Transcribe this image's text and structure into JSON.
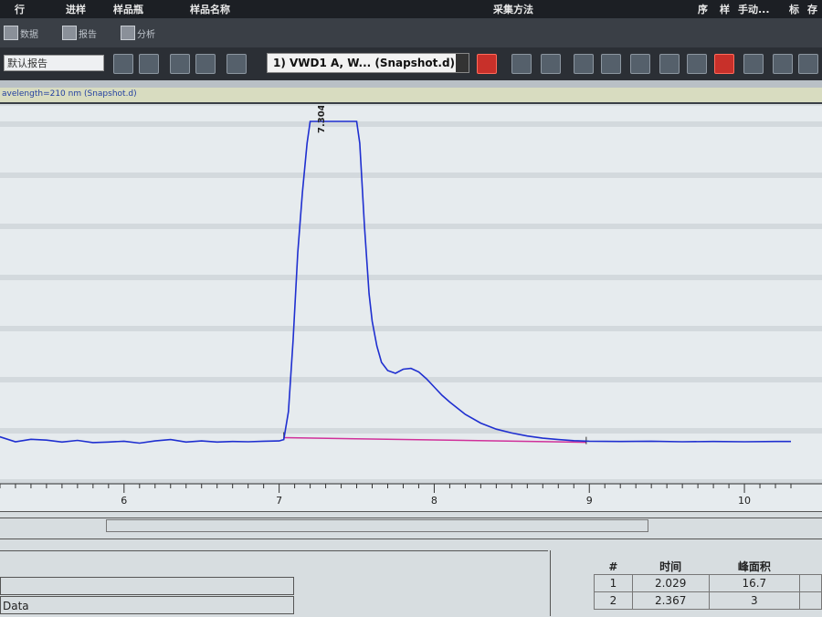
{
  "header": {
    "columns": [
      "行",
      "进样",
      "样品瓶",
      "样品名称",
      "采集方法",
      "序",
      "样",
      "手动...",
      "标",
      "存"
    ]
  },
  "mini_toolbar": {
    "items": [
      "数据",
      "报告",
      "分析"
    ]
  },
  "toolbar": {
    "report_selector": "默认报告",
    "signal_selector": "1) VWD1 A, W... (Snapshot.d)"
  },
  "signal_bar": {
    "title": "avelength=210 nm (Snapshot.d)"
  },
  "colors": {
    "trace": "#1f2fd0",
    "baseline": "#d0309a",
    "plot_bg": "#e6ebee",
    "accent_red": "#c8302a"
  },
  "chart_data": {
    "type": "line",
    "title": "",
    "xlabel": "",
    "ylabel": "",
    "xlim": [
      5.0,
      10.3
    ],
    "ylim": [
      0,
      100
    ],
    "x_ticks": [
      6,
      7,
      8,
      9,
      10
    ],
    "peak_label": "7.304",
    "peak_label_x": 7.304,
    "integration_baseline": {
      "x": [
        7.03,
        8.98
      ],
      "y": [
        2.5,
        0.8
      ]
    },
    "series": [
      {
        "x": [
          5.0,
          5.1,
          5.2,
          5.3,
          5.4,
          5.5,
          5.6,
          5.7,
          5.8,
          5.9,
          6.0,
          6.1,
          6.2,
          6.3,
          6.4,
          6.5,
          6.6,
          6.7,
          6.8,
          6.9,
          7.0,
          7.03,
          7.06,
          7.09,
          7.12,
          7.15,
          7.18,
          7.2,
          7.5,
          7.52,
          7.55,
          7.58,
          7.6,
          7.63,
          7.66,
          7.7,
          7.75,
          7.8,
          7.85,
          7.9,
          7.95,
          8.0,
          8.05,
          8.1,
          8.2,
          8.3,
          8.4,
          8.5,
          8.6,
          8.7,
          8.8,
          8.9,
          9.0,
          9.2,
          9.4,
          9.6,
          9.8,
          10.0,
          10.2,
          10.3
        ],
        "y": [
          1.0,
          1.2,
          2.8,
          1.0,
          1.9,
          1.6,
          0.9,
          1.5,
          0.7,
          0.9,
          1.2,
          0.5,
          1.3,
          1.8,
          0.9,
          1.3,
          0.9,
          1.1,
          1.0,
          1.2,
          1.3,
          1.8,
          12.0,
          38.0,
          70.0,
          92.0,
          110.0,
          118.0,
          118.0,
          110.0,
          80.0,
          55.0,
          45.0,
          36.0,
          30.0,
          27.0,
          26.0,
          27.5,
          27.8,
          26.5,
          24.0,
          21.0,
          18.0,
          15.5,
          11.0,
          7.8,
          5.6,
          4.2,
          3.1,
          2.3,
          1.8,
          1.4,
          1.2,
          1.1,
          1.2,
          1.0,
          1.1,
          1.0,
          1.1,
          1.1
        ]
      }
    ]
  },
  "results": {
    "headers": [
      "#",
      "时间",
      "峰面积"
    ],
    "rows": [
      [
        "1",
        "2.029",
        "16.7"
      ],
      [
        "2",
        "2.367",
        "3"
      ]
    ]
  },
  "lower_panel": {
    "data_label": "Data"
  }
}
